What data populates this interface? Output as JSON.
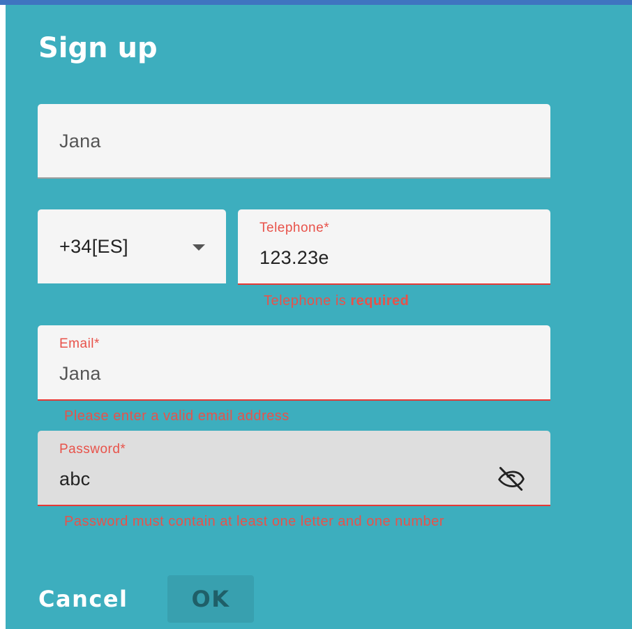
{
  "dialog": {
    "title": "Sign up",
    "background_color": "#3daebe"
  },
  "name_field": {
    "value": "Jana"
  },
  "country_code": {
    "selected": "+34[ES]",
    "icon": "chevron-down-icon"
  },
  "telephone": {
    "label": "Telephone*",
    "value": "123.23e",
    "error_prefix": "Telephone is ",
    "error_emphasis": "required"
  },
  "email": {
    "label": "Email*",
    "value": "Jana",
    "error": "Please enter a valid email address"
  },
  "password": {
    "label": "Password*",
    "value": "abc",
    "error": "Password must contain at least one letter and one number",
    "visibility_icon": "eye-off-icon"
  },
  "actions": {
    "cancel_label": "Cancel",
    "ok_label": "OK"
  },
  "colors": {
    "error": "#e8524a",
    "field_bg": "#f5f5f5",
    "focused_field_bg": "#dedede"
  }
}
